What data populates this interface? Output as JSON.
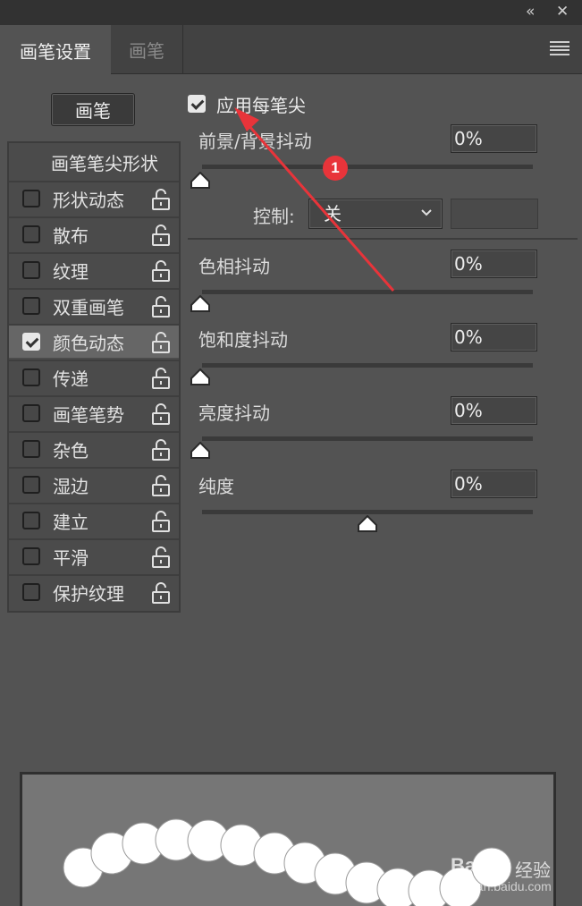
{
  "window": {
    "collapse_icon": "«",
    "close_icon": "✕"
  },
  "tabs": [
    {
      "label": "画笔设置",
      "active": true
    },
    {
      "label": "画笔",
      "active": false
    }
  ],
  "brush_button_label": "画笔",
  "options": {
    "header": "画笔笔尖形状",
    "items": [
      {
        "label": "形状动态",
        "checked": false
      },
      {
        "label": "散布",
        "checked": false
      },
      {
        "label": "纹理",
        "checked": false
      },
      {
        "label": "双重画笔",
        "checked": false
      },
      {
        "label": "颜色动态",
        "checked": true
      },
      {
        "label": "传递",
        "checked": false
      },
      {
        "label": "画笔笔势",
        "checked": false
      },
      {
        "label": "杂色",
        "checked": false
      },
      {
        "label": "湿边",
        "checked": false
      },
      {
        "label": "建立",
        "checked": false
      },
      {
        "label": "平滑",
        "checked": false
      },
      {
        "label": "保护纹理",
        "checked": false
      }
    ]
  },
  "settings": {
    "apply_per_tip": {
      "label": "应用每笔尖",
      "checked": true
    },
    "fg_bg_jitter": {
      "label": "前景/背景抖动",
      "value": "0%",
      "level": 0
    },
    "control": {
      "label": "控制:",
      "value": "关"
    },
    "hue_jitter": {
      "label": "色相抖动",
      "value": "0%",
      "level": 0
    },
    "saturation_jitter": {
      "label": "饱和度抖动",
      "value": "0%",
      "level": 0
    },
    "brightness_jitter": {
      "label": "亮度抖动",
      "value": "0%",
      "level": 0
    },
    "purity": {
      "label": "纯度",
      "value": "0%",
      "level": 0.5
    }
  },
  "annotation": {
    "badge": "1",
    "color": "#e8343a"
  },
  "watermark": {
    "brand": "Baidu",
    "product": "经验",
    "url": "jingyan.baidu.com"
  }
}
